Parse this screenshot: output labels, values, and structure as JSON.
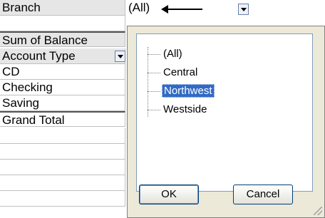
{
  "pivot": {
    "branch_label": "Branch",
    "branch_value": "(All)",
    "data_header": "Sum of Balance",
    "row_header": "Account Type",
    "rows": [
      "CD",
      "Checking",
      "Saving",
      "Grand Total"
    ]
  },
  "dropdown": {
    "items": [
      {
        "label": "(All)",
        "selected": false
      },
      {
        "label": "Central",
        "selected": false
      },
      {
        "label": "Northwest",
        "selected": true
      },
      {
        "label": "Westside",
        "selected": false
      }
    ],
    "ok_label": "OK",
    "cancel_label": "Cancel"
  },
  "colors": {
    "selection": "#316ac5",
    "header_shade": "#e6e6e6",
    "dialog_bg": "#ece9d8"
  }
}
